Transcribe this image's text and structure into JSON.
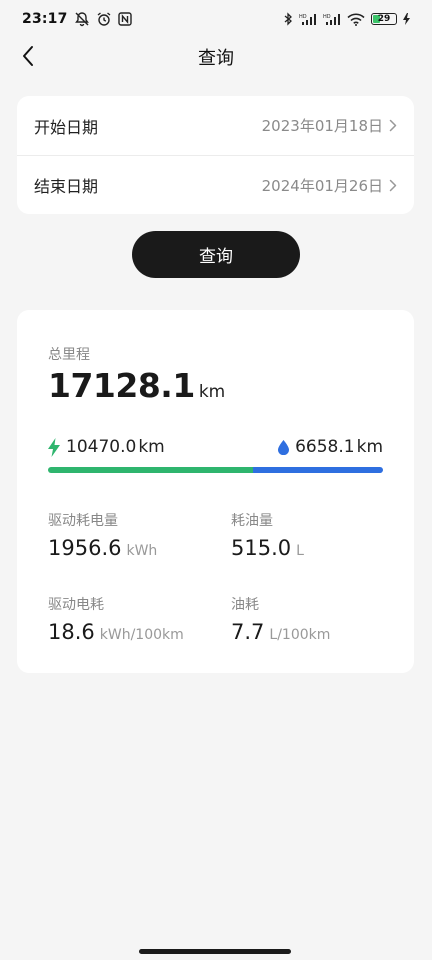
{
  "status_bar": {
    "time": "23:17",
    "battery_level": "29",
    "battery_fraction": 0.29,
    "battery_color": "#3cc46a",
    "icons_left": [
      "mute-alarm-icon",
      "alarm-clock-icon",
      "nfc-icon"
    ],
    "icons_right": [
      "bluetooth-icon",
      "signal-hd-1-icon",
      "signal-hd-2-icon",
      "wifi-icon",
      "battery-icon",
      "charging-icon"
    ]
  },
  "nav": {
    "title": "查询",
    "back_icon": "chevron-left-icon"
  },
  "date_range": {
    "start_label": "开始日期",
    "start_value": "2023年01月18日",
    "end_label": "结束日期",
    "end_value": "2024年01月26日"
  },
  "query_button": {
    "label": "查询"
  },
  "stats": {
    "total_label": "总里程",
    "total_value": "17128.1",
    "total_unit": "km",
    "electric": {
      "icon": "lightning-icon",
      "value": "10470.0",
      "unit": "km",
      "color": "#2fb56e"
    },
    "fuel": {
      "icon": "drop-icon",
      "value": "6658.1",
      "unit": "km",
      "color": "#2f6fe0"
    },
    "electric_fraction": 0.611,
    "metrics": [
      {
        "label": "驱动耗电量",
        "value": "1956.6",
        "unit": "kWh"
      },
      {
        "label": "耗油量",
        "value": "515.0",
        "unit": "L"
      },
      {
        "label": "驱动电耗",
        "value": "18.6",
        "unit": "kWh/100km"
      },
      {
        "label": "油耗",
        "value": "7.7",
        "unit": "L/100km"
      }
    ]
  }
}
